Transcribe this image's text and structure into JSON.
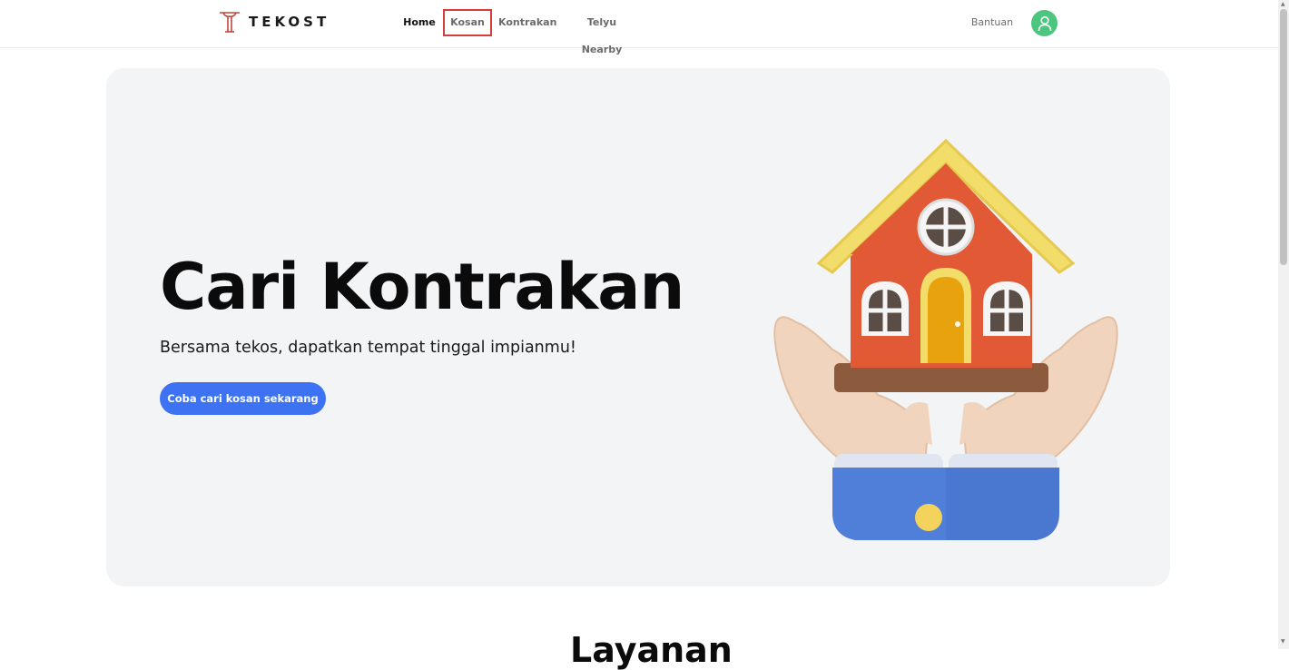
{
  "brand": {
    "name": "TEKOST",
    "logo_icon": "tekost-t-logo-icon",
    "logo_color": "#c2453a"
  },
  "nav": {
    "items": [
      {
        "label": "Home",
        "active": true
      },
      {
        "label": "Kosan",
        "highlighted": true
      },
      {
        "label": "Kontrakan"
      },
      {
        "label": "Telyu Nearby"
      }
    ],
    "help_label": "Bantuan",
    "avatar_icon": "user-icon",
    "avatar_color": "#4cc57f"
  },
  "hero": {
    "title": "Cari Kontrakan",
    "subtitle": "Bersama tekos, dapatkan tempat tinggal impianmu!",
    "cta_label": "Coba cari kosan sekarang",
    "cta_color": "#3d73f2",
    "illustration_icon": "hands-holding-house-icon"
  },
  "next_section": {
    "heading": "Layanan"
  },
  "colors": {
    "highlight_border": "#d93b3b",
    "hero_bg": "#f3f4f6"
  }
}
